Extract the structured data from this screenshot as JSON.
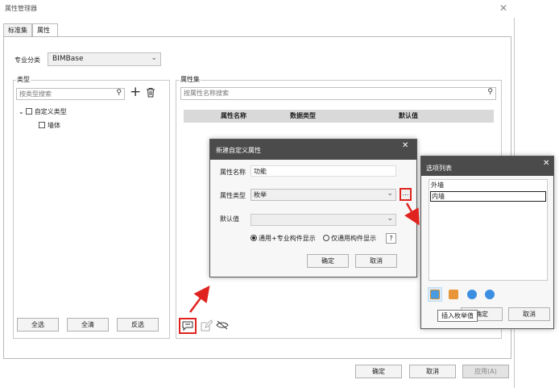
{
  "window": {
    "title": "属性管理器"
  },
  "tabs": [
    {
      "label": "标准集"
    },
    {
      "label": "属性"
    }
  ],
  "discipline": {
    "label": "专业分类",
    "value": "BIMBase"
  },
  "type_panel": {
    "title": "类型",
    "search_placeholder": "按类型搜索",
    "tree": {
      "root": "自定义类型",
      "child": "墙体"
    },
    "buttons": {
      "select_all": "全选",
      "clear_all": "全清",
      "invert": "反选"
    }
  },
  "prop_panel": {
    "title": "属性集",
    "search_placeholder": "按属性名称搜索",
    "columns": [
      "属性名称",
      "数据类型",
      "默认值"
    ]
  },
  "footer": {
    "ok": "确定",
    "cancel": "取消",
    "apply": "应用(A)"
  },
  "new_attr_dialog": {
    "title": "新建自定义属性",
    "name_label": "属性名称",
    "name_value": "功能",
    "type_label": "属性类型",
    "type_value": "枚举",
    "ellipsis": "...",
    "default_label": "默认值",
    "radio1": "通用+专业构件显示",
    "radio2": "仅通用构件显示",
    "help": "?",
    "ok": "确定",
    "cancel": "取消"
  },
  "option_list_dialog": {
    "title": "选项列表",
    "items": [
      "外墙",
      "内墙"
    ],
    "tooltip": "插入枚举值",
    "ok": "确定",
    "cancel": "取消"
  },
  "colors": {
    "highlight_red": "#e0231f",
    "dialog_title_bg": "#4b4b4b"
  }
}
